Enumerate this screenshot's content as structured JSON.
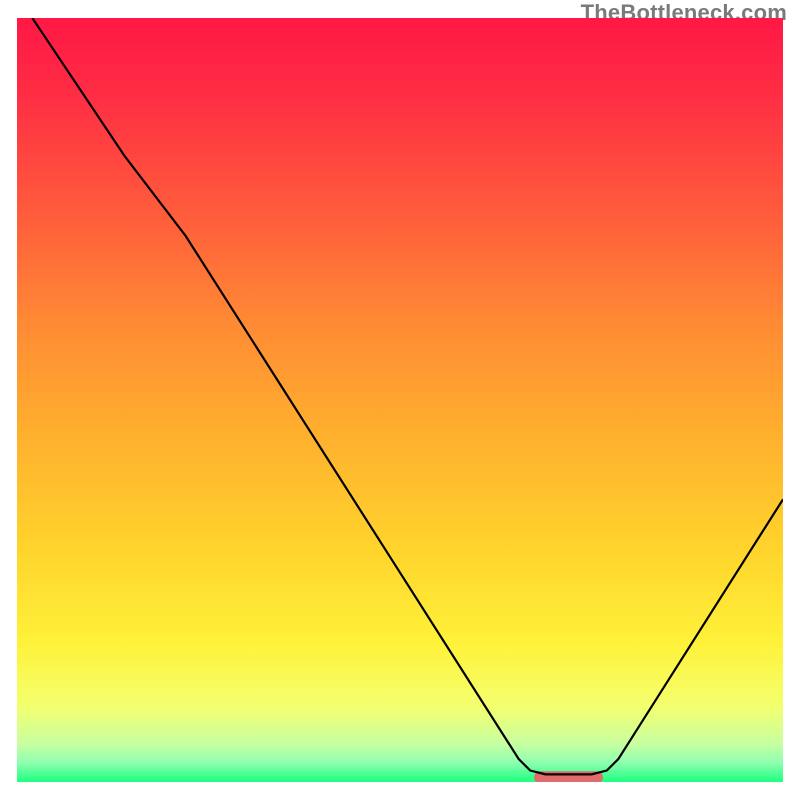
{
  "watermark": "TheBottleneck.com",
  "chart_data": {
    "type": "line",
    "title": "",
    "xlabel": "",
    "ylabel": "",
    "xlim": [
      0,
      100
    ],
    "ylim": [
      0,
      100
    ],
    "grid": false,
    "legend": false,
    "gradient_stops": [
      {
        "offset": 0.0,
        "color": "#ff1846"
      },
      {
        "offset": 0.1,
        "color": "#ff2d44"
      },
      {
        "offset": 0.25,
        "color": "#ff5a3c"
      },
      {
        "offset": 0.4,
        "color": "#ff8a34"
      },
      {
        "offset": 0.55,
        "color": "#ffb12e"
      },
      {
        "offset": 0.7,
        "color": "#ffd52c"
      },
      {
        "offset": 0.82,
        "color": "#fff23a"
      },
      {
        "offset": 0.9,
        "color": "#f4ff6e"
      },
      {
        "offset": 0.95,
        "color": "#c8ffa0"
      },
      {
        "offset": 0.975,
        "color": "#8dffb0"
      },
      {
        "offset": 1.0,
        "color": "#1cff7f"
      }
    ],
    "series": [
      {
        "name": "curve",
        "color": "#000000",
        "stroke_width": 2.2,
        "points": [
          {
            "x": 2.0,
            "y": 100.0
          },
          {
            "x": 14.0,
            "y": 82.0
          },
          {
            "x": 22.0,
            "y": 71.5
          },
          {
            "x": 65.5,
            "y": 3.0
          },
          {
            "x": 67.0,
            "y": 1.5
          },
          {
            "x": 69.0,
            "y": 1.0
          },
          {
            "x": 75.0,
            "y": 1.0
          },
          {
            "x": 77.0,
            "y": 1.5
          },
          {
            "x": 78.5,
            "y": 3.0
          },
          {
            "x": 100.0,
            "y": 37.0
          }
        ]
      }
    ],
    "marker": {
      "name": "highlight-segment",
      "color": "#e26b6b",
      "x_start": 67.5,
      "x_end": 76.5,
      "y": 0.6,
      "thickness": 1.6,
      "cap_radius": 0.8
    }
  }
}
